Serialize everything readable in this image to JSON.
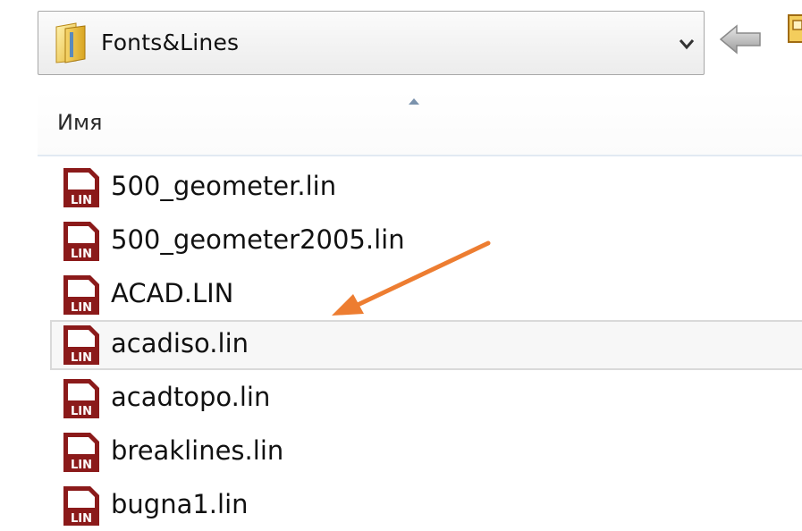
{
  "location_bar": {
    "folder_name": "Fonts&Lines",
    "folder_icon": "folder-icon",
    "dropdown_icon": "chevron-down-icon",
    "back_icon": "back-arrow-icon"
  },
  "column_header": {
    "name_label": "Имя",
    "sort": "ascending"
  },
  "files": [
    {
      "name": "500_geometer.lin",
      "icon": "lin-file-icon",
      "selected": false
    },
    {
      "name": "500_geometer2005.lin",
      "icon": "lin-file-icon",
      "selected": false
    },
    {
      "name": "ACAD.LIN",
      "icon": "lin-file-icon",
      "selected": false
    },
    {
      "name": "acadiso.lin",
      "icon": "lin-file-icon",
      "selected": true
    },
    {
      "name": "acadtopo.lin",
      "icon": "lin-file-icon",
      "selected": false
    },
    {
      "name": "breaklines.lin",
      "icon": "lin-file-icon",
      "selected": false
    },
    {
      "name": "bugna1.lin",
      "icon": "lin-file-icon",
      "selected": false
    }
  ],
  "file_icon_text": "LIN",
  "annotation": {
    "color": "#ed7d31",
    "points_to": "acadiso.lin"
  },
  "colors": {
    "file_icon_red": "#8b1a1a",
    "selection_border": "#d9d9d9"
  }
}
